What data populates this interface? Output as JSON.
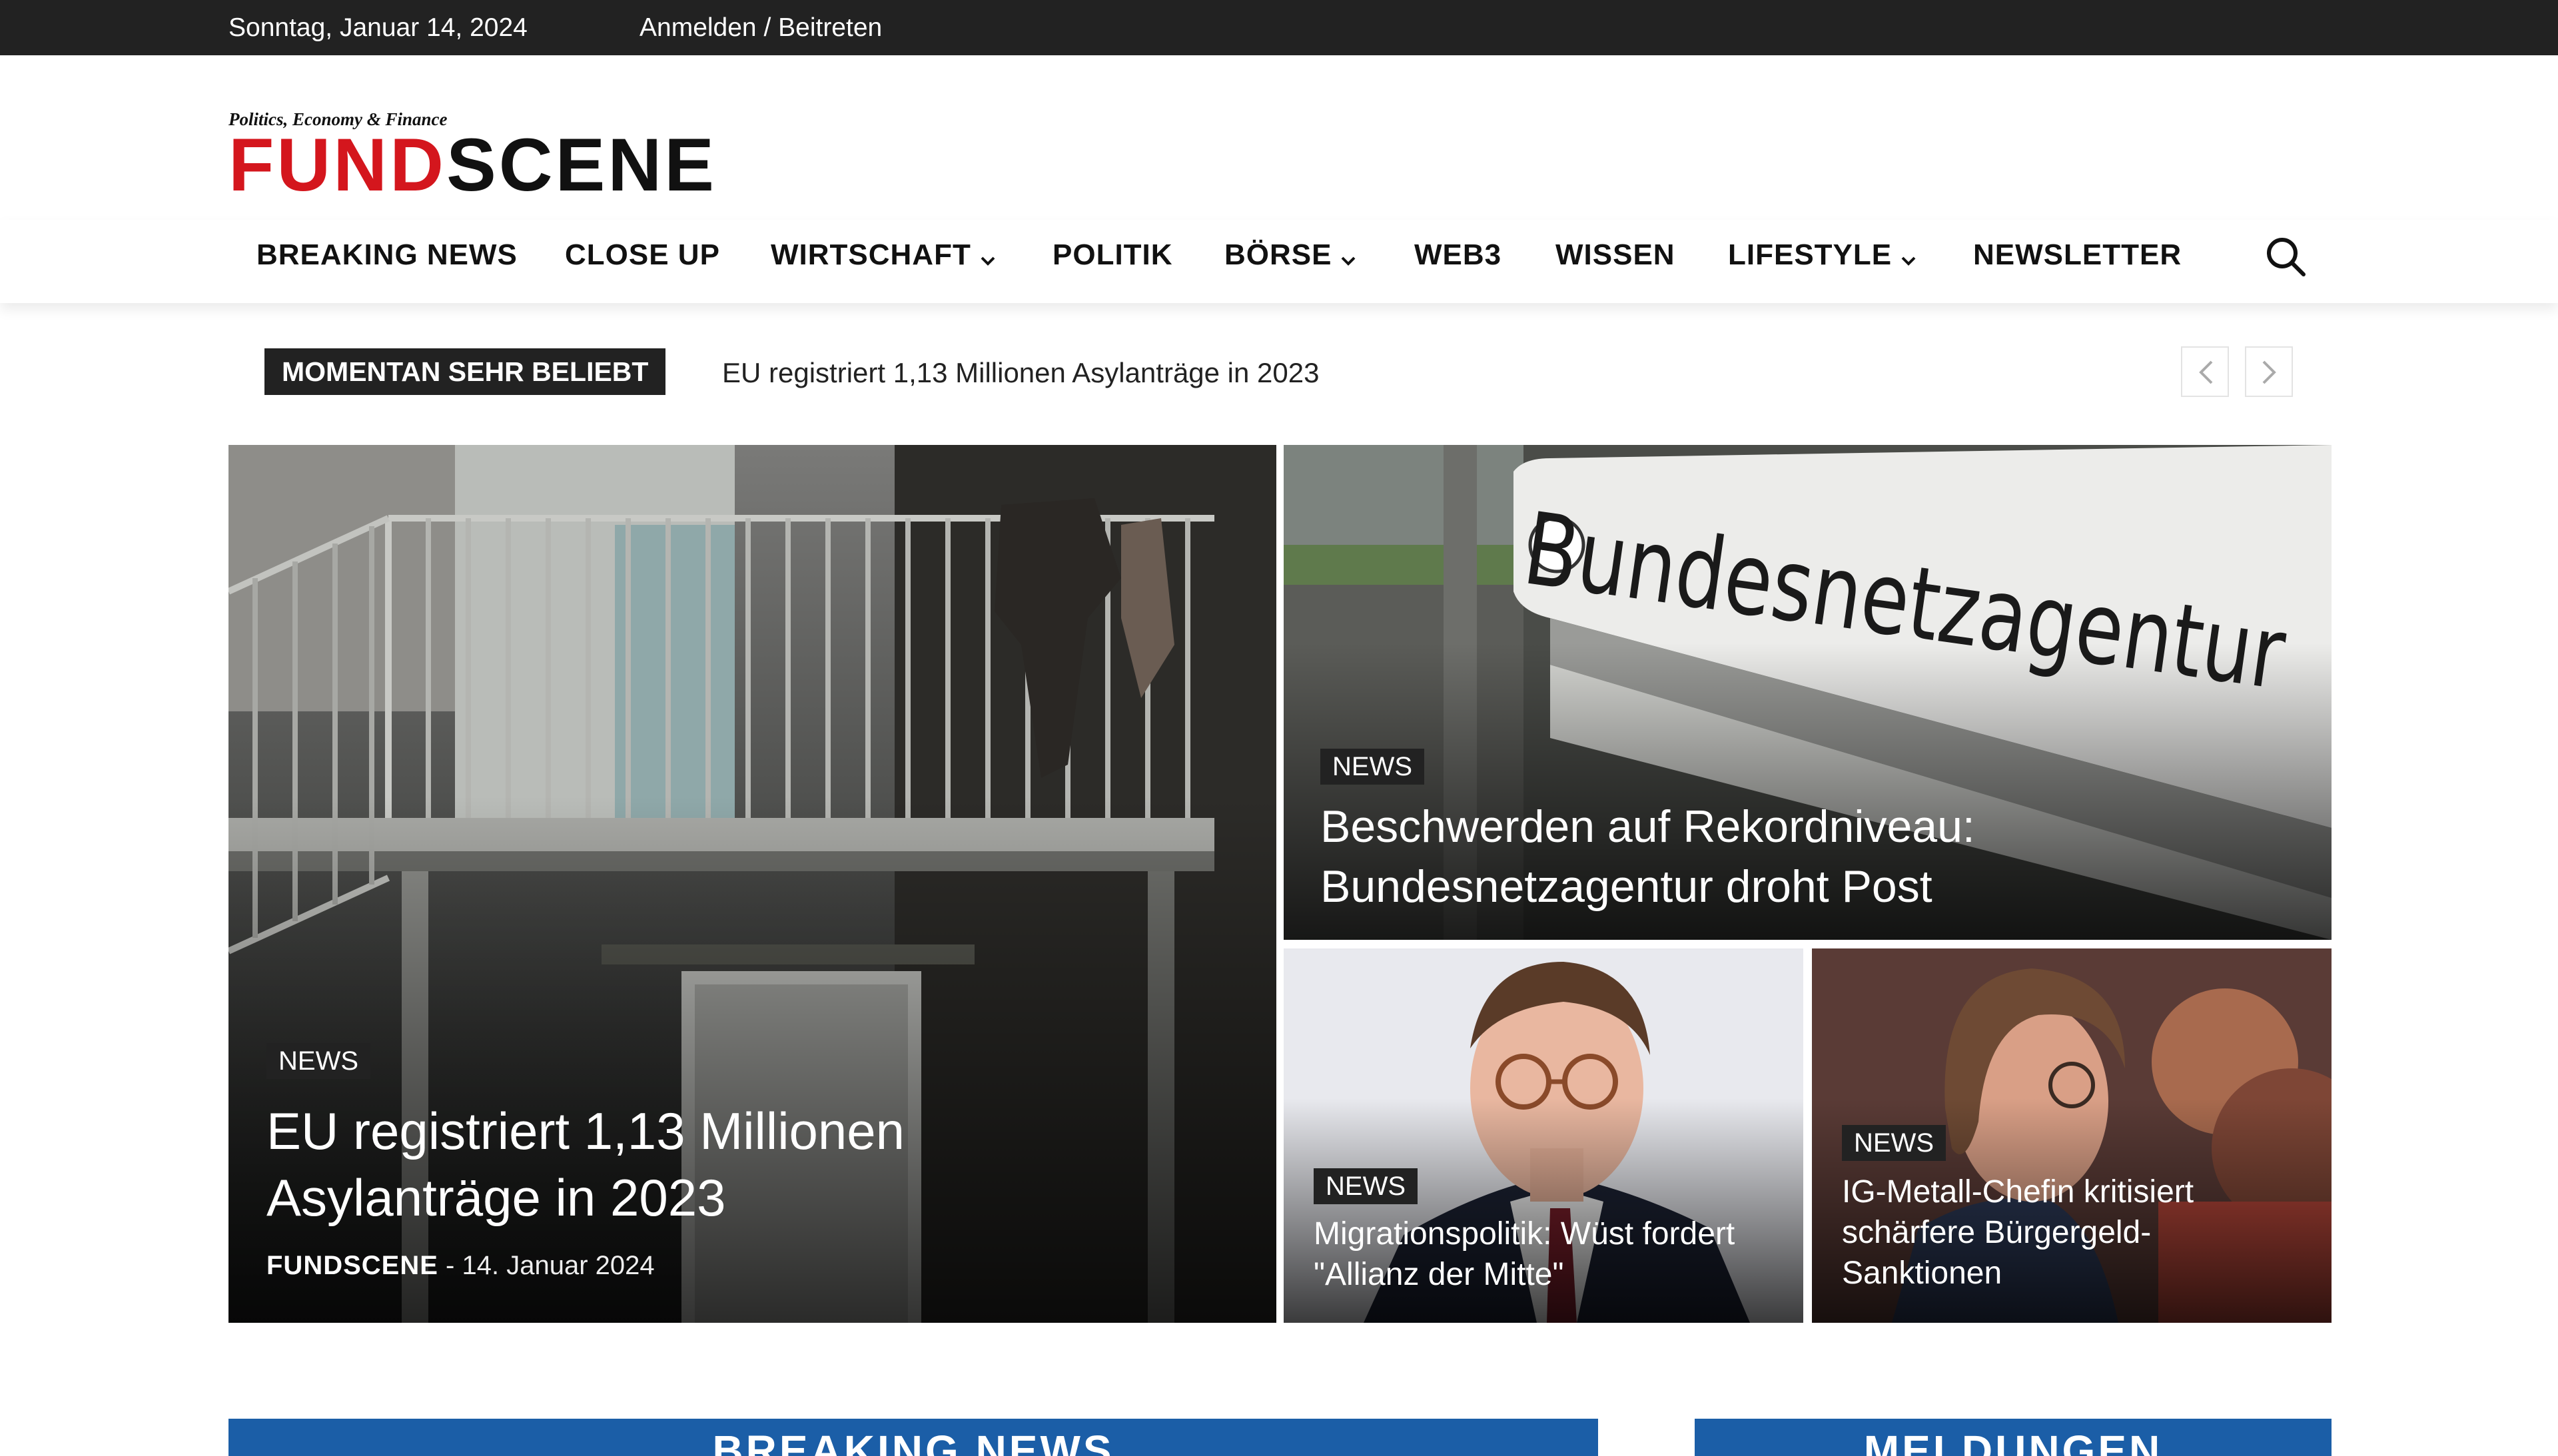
{
  "topbar": {
    "date": "Sonntag, Januar 14, 2024",
    "login": "Anmelden / Beitreten"
  },
  "logo": {
    "tagline": "Politics, Economy & Finance",
    "fund": "FUND",
    "scene": "SCENE"
  },
  "nav": {
    "items": [
      {
        "label": "BREAKING NEWS",
        "dropdown": false
      },
      {
        "label": "CLOSE UP",
        "dropdown": false
      },
      {
        "label": "WIRTSCHAFT",
        "dropdown": true
      },
      {
        "label": "POLITIK",
        "dropdown": false
      },
      {
        "label": "BÖRSE",
        "dropdown": true
      },
      {
        "label": "WEB3",
        "dropdown": false
      },
      {
        "label": "WISSEN",
        "dropdown": false
      },
      {
        "label": "LIFESTYLE",
        "dropdown": true
      },
      {
        "label": "NEWSLETTER",
        "dropdown": false
      }
    ],
    "search_icon": "search-icon"
  },
  "ticker": {
    "label": "MOMENTAN SEHR BELIEBT",
    "headline": "EU registriert 1,13 Millionen Asylanträge in 2023"
  },
  "featured": [
    {
      "category": "NEWS",
      "title": "EU registriert 1,13 Millionen Asylanträge in 2023",
      "author": "FUNDSCENE",
      "separator": "-",
      "date": "14. Januar 2024"
    },
    {
      "category": "NEWS",
      "title": "Beschwerden auf Rekordniveau: Bundesnetzagentur droht Post",
      "sign_text": "Bundesnetzagentur"
    },
    {
      "category": "NEWS",
      "title": "Migrationspolitik: Wüst fordert \"Allianz der Mitte\""
    },
    {
      "category": "NEWS",
      "title": "IG-Metall-Chefin kritisiert schärfere Bürgergeld-Sanktionen"
    }
  ],
  "sections": {
    "breaking": "BREAKING NEWS",
    "meldungen": "MELDUNGEN"
  },
  "colors": {
    "accent_red": "#d4161d",
    "topbar": "#222222",
    "section_blue": "#1b5ea7"
  }
}
